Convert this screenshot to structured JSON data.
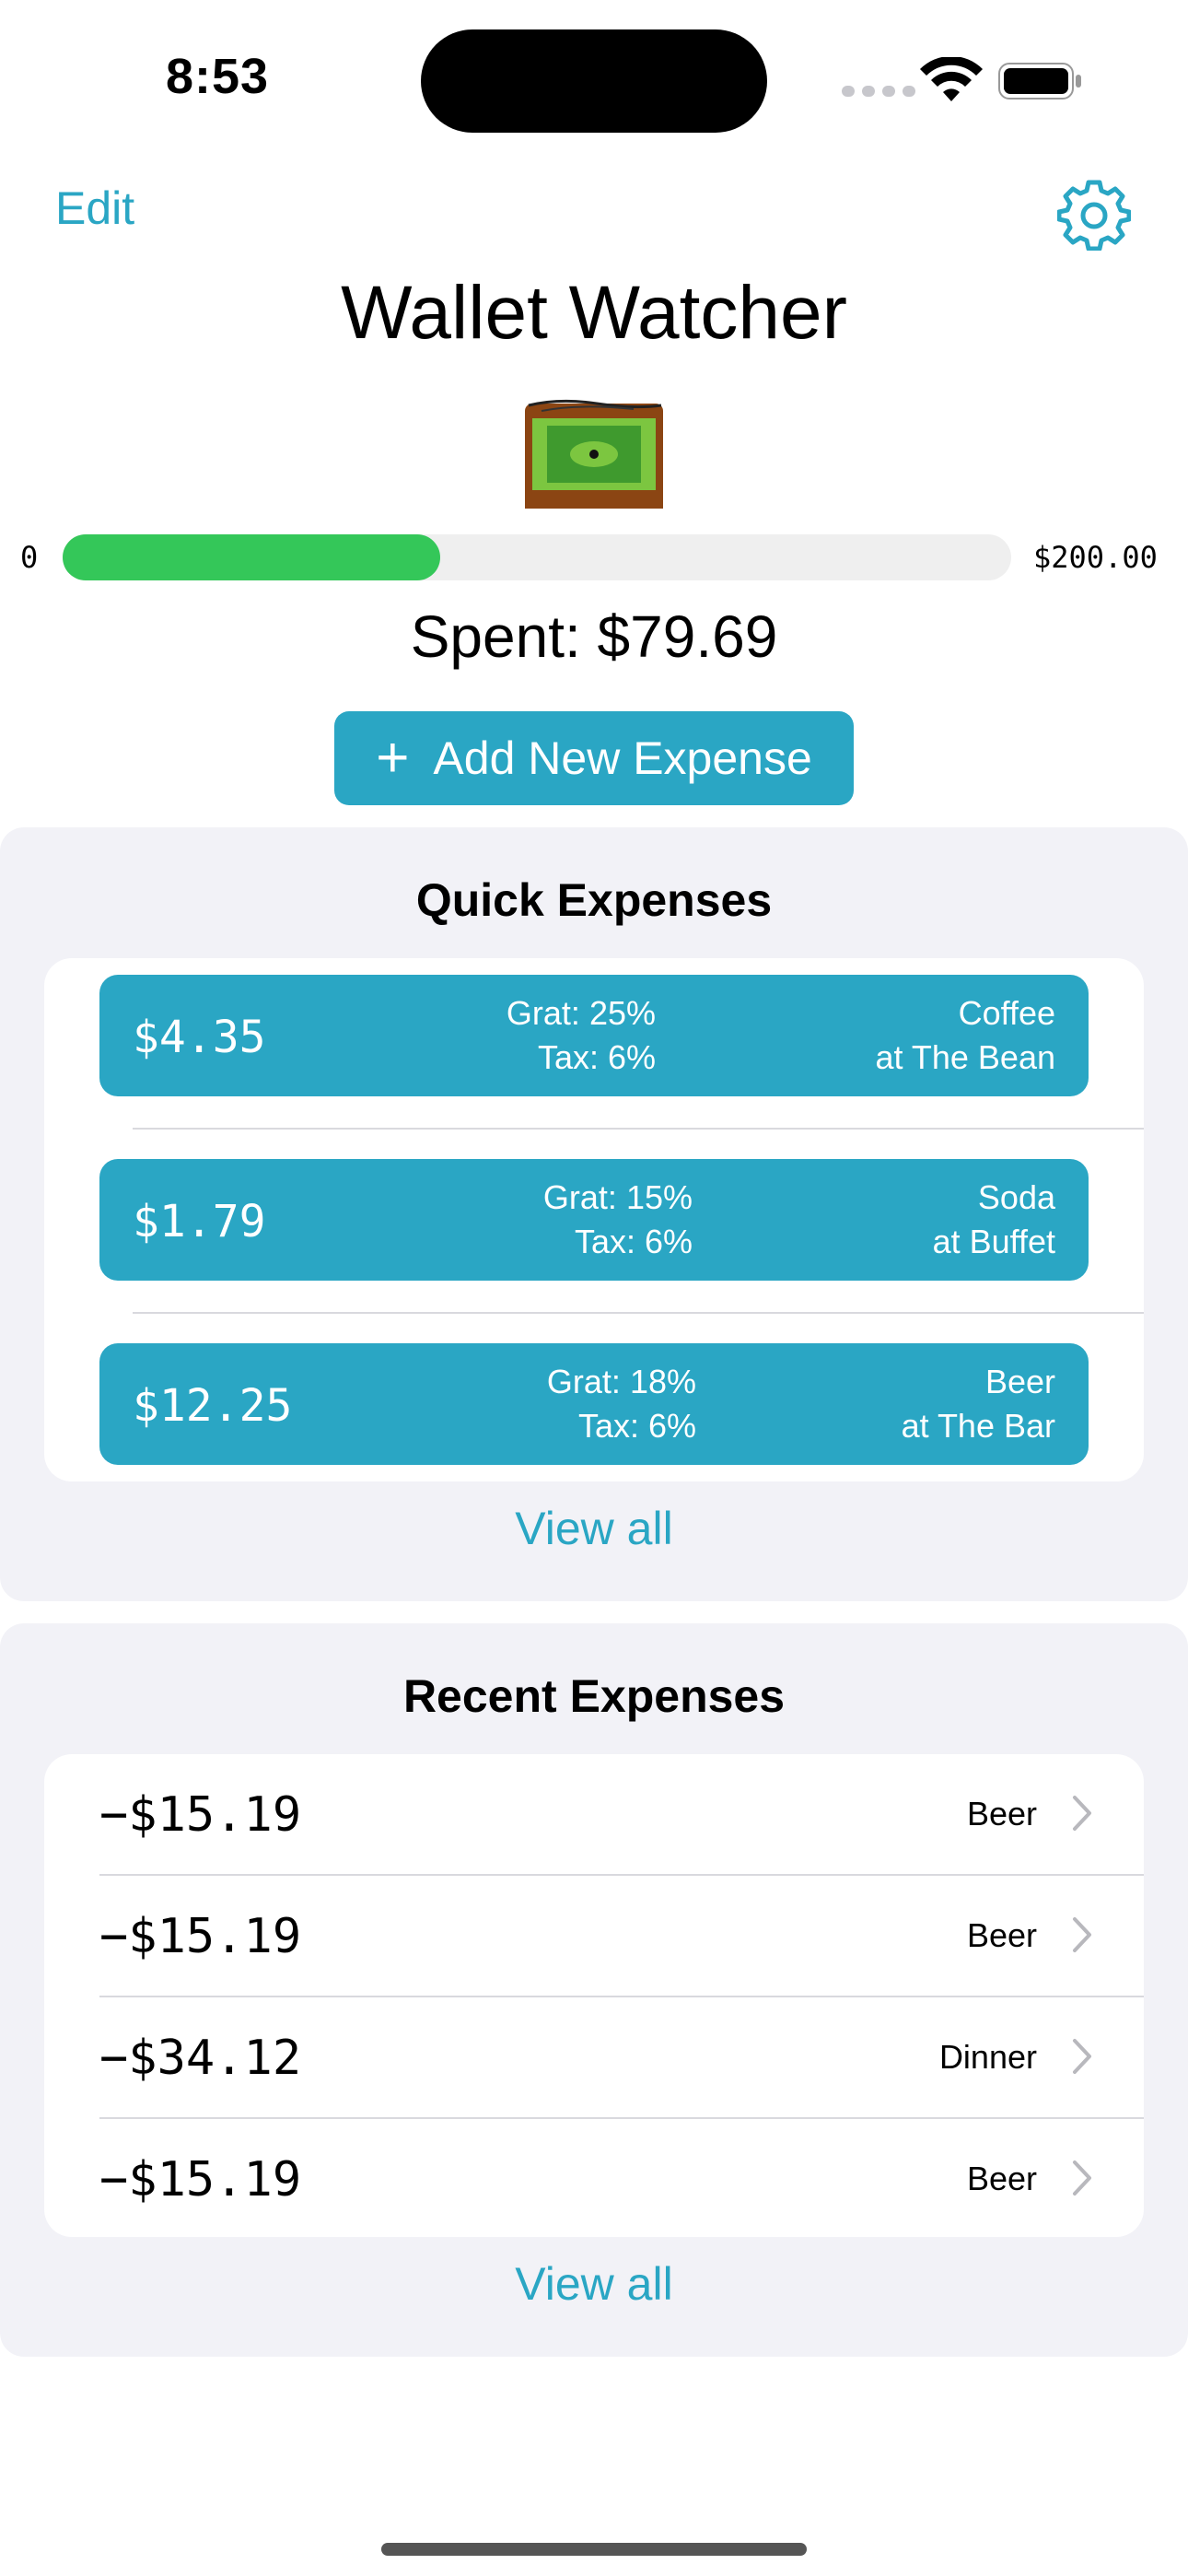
{
  "status_bar": {
    "time": "8:53"
  },
  "nav": {
    "edit_label": "Edit",
    "settings_icon": "gear-icon",
    "title": "Wallet Watcher"
  },
  "budget": {
    "min_label": "0",
    "max_label": "$200.00",
    "progress_fraction": 0.398,
    "spent_text": "Spent: $79.69",
    "bar_color": "#34c759"
  },
  "add_button": {
    "label": "Add New Expense"
  },
  "quick": {
    "title": "Quick Expenses",
    "items": [
      {
        "amount": "$4.35",
        "grat": "Grat: 25%",
        "tax": "Tax: 6%",
        "name": "Coffee",
        "place": "at The Bean"
      },
      {
        "amount": "$1.79",
        "grat": "Grat: 15%",
        "tax": "Tax: 6%",
        "name": "Soda",
        "place": "at Buffet"
      },
      {
        "amount": "$12.25",
        "grat": "Grat: 18%",
        "tax": "Tax: 6%",
        "name": "Beer",
        "place": "at The Bar"
      }
    ],
    "view_all": "View all"
  },
  "recent": {
    "title": "Recent Expenses",
    "items": [
      {
        "amount": "−$15.19",
        "label": "Beer"
      },
      {
        "amount": "−$15.19",
        "label": "Beer"
      },
      {
        "amount": "−$34.12",
        "label": "Dinner"
      },
      {
        "amount": "−$15.19",
        "label": "Beer"
      }
    ],
    "view_all": "View all"
  },
  "colors": {
    "accent": "#2aa6c4",
    "section_bg": "#f2f2f7"
  }
}
